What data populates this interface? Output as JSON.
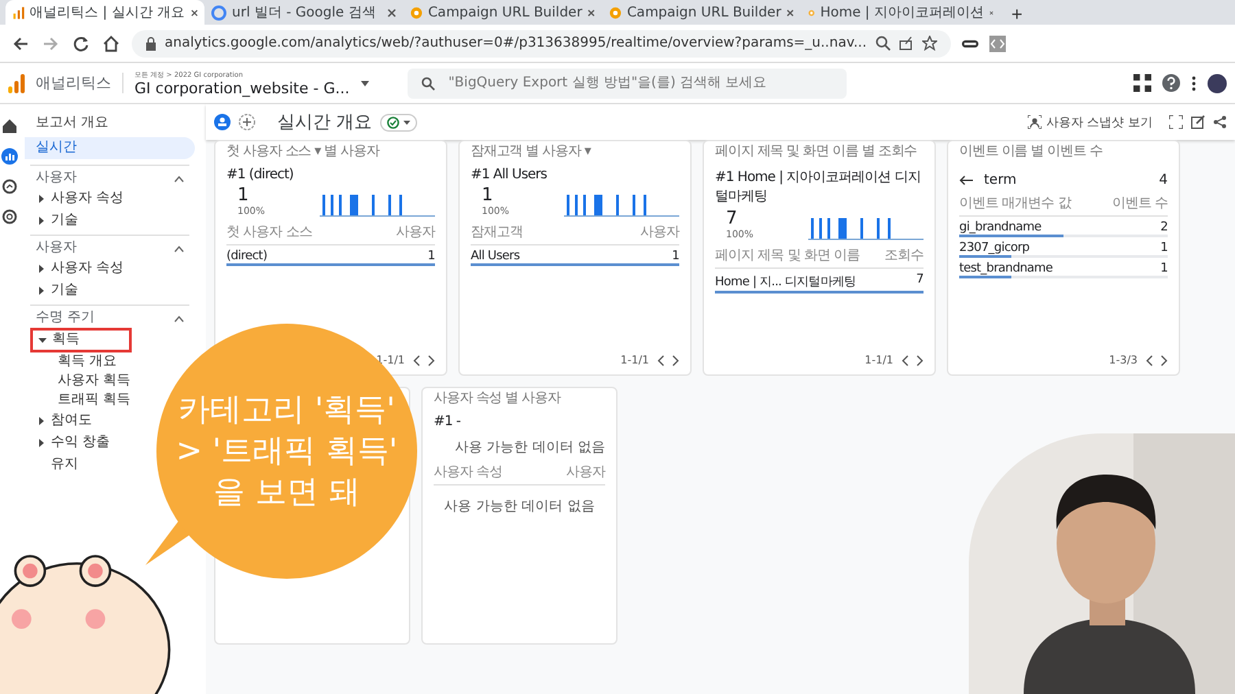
{
  "browser": {
    "tabs": [
      {
        "title": "애널리틱스 | 실시간 개요",
        "selected": true
      },
      {
        "title": "url 빌더 - Google 검색",
        "selected": false
      },
      {
        "title": "Campaign URL Builder",
        "selected": false
      },
      {
        "title": "Campaign URL Builder",
        "selected": false
      },
      {
        "title": "Home | 지아이코퍼레이션",
        "selected": false
      }
    ],
    "new_tab": "+",
    "url": "analytics.google.com/analytics/web/?authuser=0#/p313638995/realtime/overview?params=_u..nav..."
  },
  "header": {
    "app_name": "애널리틱스",
    "breadcrumb": "모든 계정 > 2022 GI corporation",
    "property": "GI corporation_website - G...",
    "search": {
      "placeholder": "\"BigQuery Export 실행 방법\"을(를) 검색해 보세요"
    }
  },
  "rail": [
    {
      "selected": false
    },
    {
      "selected": true
    },
    {
      "selected": false
    },
    {
      "selected": false
    }
  ],
  "sidebar": [
    {
      "kind": "link",
      "label": "보고서 개요",
      "selected": false
    },
    {
      "kind": "link",
      "label": "실시간",
      "selected": true
    },
    {
      "kind": "section",
      "label": "사용자",
      "expanded": true,
      "children": [
        {
          "kind": "group",
          "label": "사용자 속성",
          "expanded": false,
          "highlighted": false
        },
        {
          "kind": "group",
          "label": "기술",
          "expanded": false,
          "highlighted": false
        }
      ]
    },
    {
      "kind": "section",
      "label": "사용자",
      "expanded": true,
      "children": [
        {
          "kind": "group",
          "label": "사용자 속성",
          "expanded": false,
          "highlighted": false
        },
        {
          "kind": "group",
          "label": "기술",
          "expanded": false,
          "highlighted": false
        }
      ]
    },
    {
      "kind": "section",
      "label": "수명 주기",
      "expanded": true,
      "children": [
        {
          "kind": "group",
          "label": "획득",
          "expanded": true,
          "highlighted": true,
          "children": [
            {
              "label": "획득 개요"
            },
            {
              "label": "사용자 획득"
            },
            {
              "label": "트래픽 획득"
            }
          ]
        },
        {
          "kind": "group",
          "label": "참여도",
          "expanded": false,
          "highlighted": false
        },
        {
          "kind": "group",
          "label": "수익 창출",
          "expanded": false,
          "highlighted": false
        },
        {
          "kind": "leaf",
          "label": "유지",
          "highlighted": false
        }
      ]
    }
  ],
  "page": {
    "title": "실시간 개요",
    "snapshot": "사용자 스냅샷 보기"
  },
  "cards": [
    {
      "kind": "summary",
      "title": "첫 사용자 소스 ▾ 별 사용자",
      "top": "#1  (direct)",
      "value": "1",
      "percent": "100%",
      "col_left": "첫 사용자 소스",
      "col_right": "사용자",
      "rows": [
        {
          "label": "(direct)",
          "value": "1",
          "level": 1
        }
      ],
      "pager": "1-1/1"
    },
    {
      "kind": "summary",
      "title": "잠재고객 별 사용자 ▾",
      "top": "#1  All Users",
      "value": "1",
      "percent": "100%",
      "col_left": "잠재고객",
      "col_right": "사용자",
      "rows": [
        {
          "label": "All Users",
          "value": "1",
          "level": 1
        }
      ],
      "pager": "1-1/1"
    },
    {
      "kind": "summary",
      "title": "페이지 제목 및 화면 이름 별 조회수",
      "top": "#1  Home | 지아이코퍼레이션 디지털마케팅",
      "value": "7",
      "percent": "100%",
      "col_left": "페이지 제목 및 화면 이름",
      "col_right": "조회수",
      "rows": [
        {
          "label": "Home | 지... 디지털마케팅",
          "value": "7",
          "level": 1
        }
      ],
      "pager": "1-1/1"
    },
    {
      "kind": "drilldown",
      "title": "이벤트 이름 별 이벤트 수",
      "top": "term",
      "value": "4",
      "col_left": "이벤트 매개변수 값",
      "col_right": "이벤트 수",
      "rows": [
        {
          "label": "gi_brandname",
          "value": "2",
          "level": 0.5
        },
        {
          "label": "2307_gicorp",
          "value": "1",
          "level": 0.25
        },
        {
          "label": "test_brandname",
          "value": "1",
          "level": 0.25
        }
      ],
      "pager": "1-3/3"
    },
    {
      "kind": "blank"
    },
    {
      "kind": "empty",
      "title": "사용자 속성 별 사용자",
      "top": "#1  -",
      "message": "사용 가능한 데이터 없음",
      "col_left": "사용자 속성",
      "col_right": "사용자",
      "message2": "사용 가능한 데이터 없음"
    }
  ],
  "callout": {
    "lines": [
      "카테고리 '획득'",
      "> '트래픽 획득'",
      "을 보면 돼"
    ]
  }
}
